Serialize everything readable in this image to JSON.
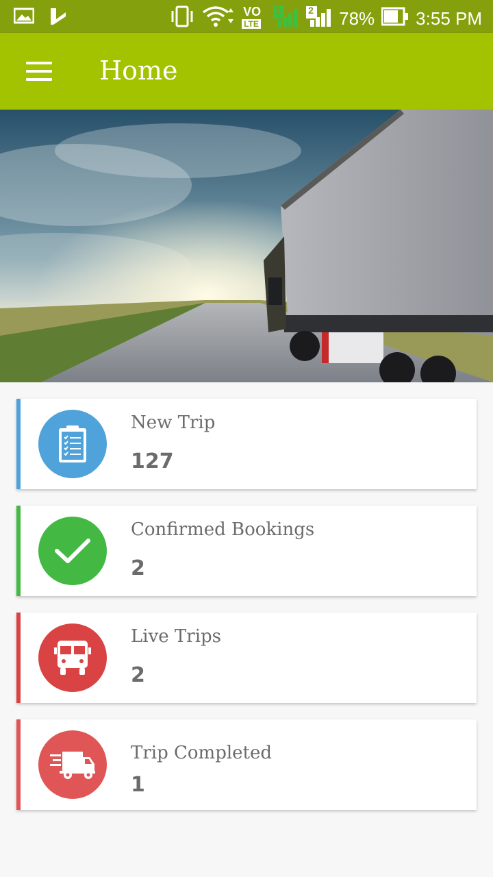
{
  "status_bar": {
    "battery": "78%",
    "time": "3:55 PM",
    "network_label": "VO",
    "lte_label": "LTE",
    "sim1": "1",
    "sim2": "2"
  },
  "app_bar": {
    "title": "Home"
  },
  "cards": [
    {
      "label": "New Trip",
      "count": "127",
      "color": "#4fa3da",
      "icon": "clipboard-checklist-icon"
    },
    {
      "label": "Confirmed Bookings",
      "count": "2",
      "color": "#43b843",
      "icon": "checkmark-icon"
    },
    {
      "label": "Live Trips",
      "count": "2",
      "color": "#d94343",
      "icon": "bus-icon"
    },
    {
      "label": "Trip Completed",
      "count": "1",
      "color": "#e05555",
      "icon": "fast-delivery-truck-icon"
    }
  ]
}
